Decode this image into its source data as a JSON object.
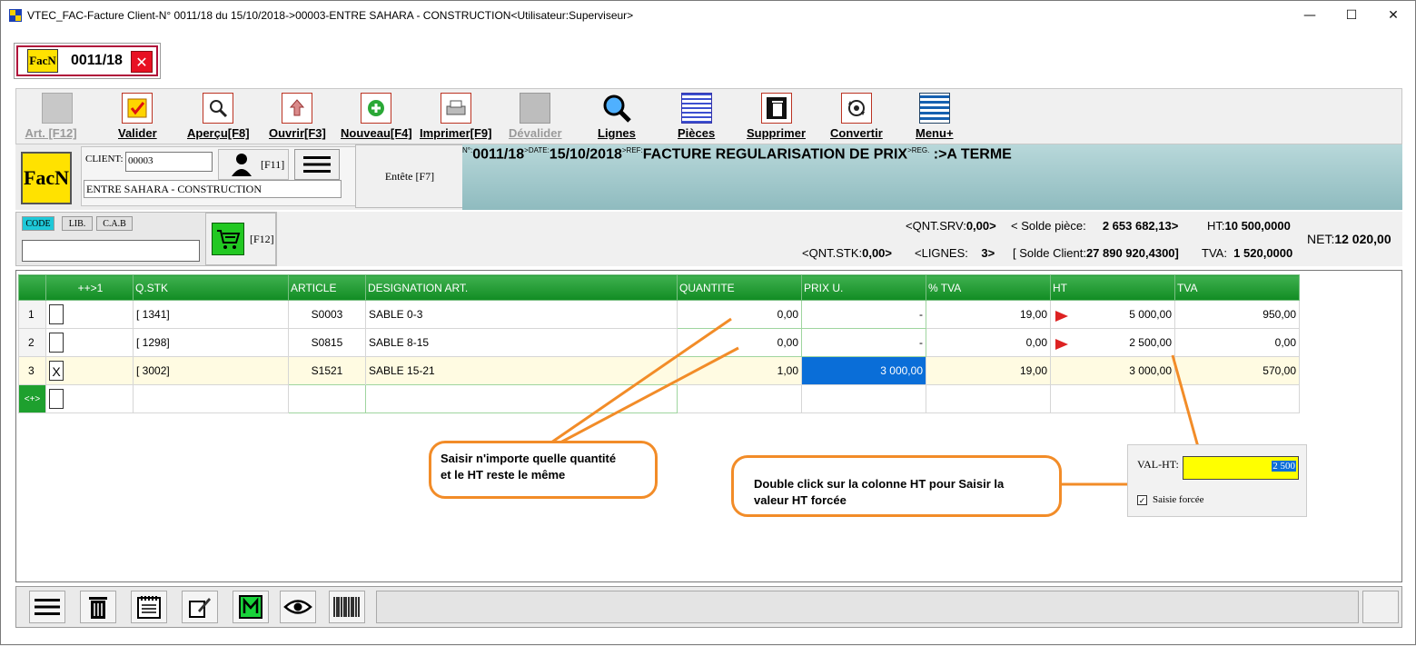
{
  "window": {
    "title": "VTEC_FAC-Facture Client-N° 0011/18 du 15/10/2018->00003-ENTRE SAHARA - CONSTRUCTION<Utilisateur:Superviseur>",
    "min": "—",
    "max": "☐",
    "close": "✕"
  },
  "doc_tab": {
    "logo": "FacN",
    "number": "0011/18",
    "close": "✕"
  },
  "toolbar": [
    {
      "label": "Art. [F12]",
      "icon": "article-icon",
      "disabled": true
    },
    {
      "label": "Valider",
      "icon": "check-icon",
      "disabled": false
    },
    {
      "label": "Aperçu[F8]",
      "icon": "preview-icon",
      "disabled": false
    },
    {
      "label": "Ouvrir[F3]",
      "icon": "open-icon",
      "disabled": false
    },
    {
      "label": "Nouveau[F4]",
      "icon": "add-icon",
      "disabled": false
    },
    {
      "label": "Imprimer[F9]",
      "icon": "print-icon",
      "disabled": false
    },
    {
      "label": "Dévalider",
      "icon": "unvalidate-icon",
      "disabled": true
    },
    {
      "label": "Lignes",
      "icon": "search-lines-icon",
      "disabled": false
    },
    {
      "label": "Pièces",
      "icon": "pieces-icon",
      "disabled": false
    },
    {
      "label": "Supprimer",
      "icon": "trash-icon",
      "disabled": false
    },
    {
      "label": "Convertir",
      "icon": "convert-icon",
      "disabled": false
    },
    {
      "label": "Menu+",
      "icon": "menu-icon",
      "disabled": false
    }
  ],
  "client": {
    "logo": "FacN",
    "label": "CLIENT:",
    "code": "00003",
    "name": "ENTRE SAHARA - CONSTRUCTION",
    "f11": "[F11]",
    "entete": "Entête [F7]"
  },
  "header": {
    "no_label": "N°:",
    "no": "0011/18",
    "date_label": ">DATE:",
    "date": "15/10/2018",
    "ref_label": ">REF:",
    "ref": "FACTURE REGULARISATION DE PRIX",
    "reg_label": ">REG.",
    "reg": ":>A TERME"
  },
  "search": {
    "modes": [
      "CODE",
      "LIB.",
      "C.A.B"
    ],
    "active_mode": "CODE",
    "value": "",
    "cart_shortcut": "[F12]"
  },
  "totals": {
    "qnt_srv_label": "<QNT.SRV:",
    "qnt_srv": "0,00>",
    "solde_piece_label": "< Solde pièce:",
    "solde_piece": "2 653 682,13>",
    "ht_label": "HT:",
    "ht": "10 500,0000",
    "qnt_stk_label": "<QNT.STK:",
    "qnt_stk": "0,00>",
    "lignes_label": "<LIGNES:",
    "lignes": "3>",
    "solde_client_label": "[ Solde Client:",
    "solde_client": "27 890 920,4300]",
    "tva_label": "TVA:",
    "tva": "1 520,0000",
    "net_label": "NET:",
    "net": "12 020,00"
  },
  "grid": {
    "columns": [
      "",
      "++>1",
      "Q.STK",
      "ARTICLE",
      "DESIGNATION ART.",
      "QUANTITE",
      "PRIX U.",
      "% TVA",
      "HT",
      "TVA"
    ],
    "rows": [
      {
        "num": "1",
        "check": "",
        "qstk": "[ 1341]",
        "article": "S0003",
        "designation": "SABLE 0-3",
        "quantite": "0,00",
        "prix": "-",
        "tva_pct": "19,00",
        "ht": "5 000,00",
        "tva": "950,00",
        "forced": true
      },
      {
        "num": "2",
        "check": "",
        "qstk": "[ 1298]",
        "article": "S0815",
        "designation": "SABLE 8-15",
        "quantite": "0,00",
        "prix": "-",
        "tva_pct": "0,00",
        "ht": "2 500,00",
        "tva": "0,00",
        "forced": true
      },
      {
        "num": "3",
        "check": "X",
        "qstk": "[ 3002]",
        "article": "S1521",
        "designation": "SABLE 15-21",
        "quantite": "1,00",
        "prix": "3 000,00",
        "tva_pct": "19,00",
        "ht": "3 000,00",
        "tva": "570,00",
        "forced": false
      }
    ],
    "new_row_marker": "<+>"
  },
  "callouts": {
    "quantity": "Saisir n'importe quelle quantité\n et le HT reste le même",
    "ht": "Double click sur la colonne HT pour Saisir la valeur HT forcée"
  },
  "valht_popup": {
    "label": "VAL-HT:",
    "value": "2 500",
    "checkbox_label": "Saisie forcée",
    "checked": true
  },
  "bottom_bar": [
    "menu-icon",
    "trash-icon",
    "calendar-icon",
    "edit-icon",
    "m-icon",
    "eye-icon",
    "barcode-icon"
  ],
  "colors": {
    "grid_header": "#118c23",
    "callout_border": "#f28c28",
    "selection": "#0a6ed8",
    "header_band": "#9cc5c8",
    "logo": "#ffe200"
  }
}
